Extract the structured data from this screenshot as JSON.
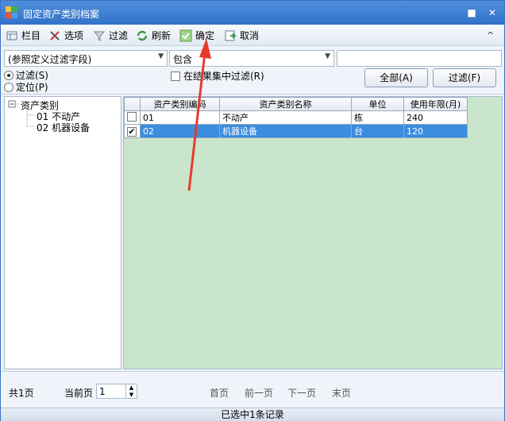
{
  "window": {
    "title": "固定资产类别档案",
    "close_glyph": "■",
    "max_glyph": "✕"
  },
  "toolbar": {
    "columns": "栏目",
    "options": "选项",
    "filter": "过滤",
    "refresh": "刷新",
    "ok": "确定",
    "cancel": "取消",
    "collapse_glyph": "^"
  },
  "filter": {
    "field_combo": "(参照定义过滤字段)",
    "operator_combo": "包含",
    "value_input": "",
    "radio_filter": "过滤(S)",
    "radio_locate": "定位(P)",
    "in_results": "在结果集中过滤(R)",
    "all_button": "全部(A)",
    "filter_button": "过滤(F)"
  },
  "tree": {
    "root": "资产类别",
    "children": [
      "01 不动产",
      "02 机器设备"
    ]
  },
  "grid": {
    "headers": [
      "资产类别编码",
      "资产类别名称",
      "单位",
      "使用年限(月)"
    ],
    "rows": [
      {
        "checked": false,
        "code": "01",
        "name": "不动产",
        "unit": "栋",
        "years": "240"
      },
      {
        "checked": true,
        "code": "02",
        "name": "机器设备",
        "unit": "台",
        "years": "120"
      }
    ]
  },
  "pager": {
    "total": "共1页",
    "current_label": "当前页",
    "current_value": "1",
    "first": "首页",
    "prev": "前一页",
    "next": "下一页",
    "last": "末页"
  },
  "status": "已选中1条记录",
  "colors": {
    "title": "#3a7bd5",
    "selection": "#3b8de0",
    "grid_bg": "#c9e5cc",
    "annotation": "#e53b2c"
  }
}
